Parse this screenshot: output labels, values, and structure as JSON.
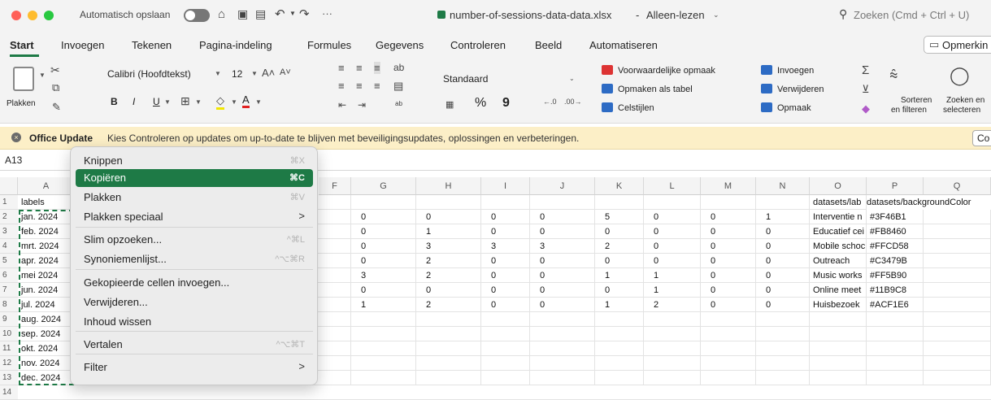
{
  "titlebar": {
    "autosave_label": "Automatisch opslaan",
    "more": "···",
    "file_name": "number-of-sessions-data-data.xlsx",
    "read_only": "Alleen-lezen",
    "search_placeholder": "Zoeken (Cmd + Ctrl + U)"
  },
  "tabs": [
    "Start",
    "Invoegen",
    "Tekenen",
    "Pagina-indeling",
    "Formules",
    "Gegevens",
    "Controleren",
    "Beeld",
    "Automatiseren"
  ],
  "comment_button": "Opmerkin",
  "ribbon": {
    "paste": "Plakken",
    "font_name": "Calibri (Hoofdtekst)",
    "font_size": "12",
    "bold": "B",
    "italic": "I",
    "underline": "U",
    "number_format": "Standaard",
    "percent": "%",
    "comma": "9",
    "cond_format": "Voorwaardelijke opmaak",
    "format_table": "Opmaken als tabel",
    "cell_styles": "Celstijlen",
    "insert": "Invoegen",
    "delete": "Verwijderen",
    "format": "Opmaak",
    "sort_filter_1": "Sorteren",
    "sort_filter_2": "en filteren",
    "find_select_1": "Zoeken en",
    "find_select_2": "selecteren"
  },
  "update_bar": {
    "title": "Office Update",
    "message": "Kies Controleren op updates om up-to-date te blijven met beveiligingsupdates, oplossingen en verbeteringen.",
    "button": "Co"
  },
  "formula_bar": {
    "name_box": "A13"
  },
  "columns": [
    "A",
    "F",
    "G",
    "H",
    "I",
    "J",
    "K",
    "L",
    "M",
    "N",
    "O",
    "P",
    "Q"
  ],
  "rows": [
    "1",
    "2",
    "3",
    "4",
    "5",
    "6",
    "7",
    "8",
    "9",
    "10",
    "11",
    "12",
    "13",
    "14"
  ],
  "col_a": [
    "labels",
    "jan. 2024",
    "feb. 2024",
    "mrt. 2024",
    "apr. 2024",
    "mei 2024",
    "jun. 2024",
    "jul. 2024",
    "aug. 2024",
    "sep. 2024",
    "okt. 2024",
    "nov. 2024",
    "dec. 2024"
  ],
  "data_rows": [
    [
      "0",
      "0",
      "0",
      "0",
      "5",
      "0",
      "0",
      "1"
    ],
    [
      "0",
      "1",
      "0",
      "0",
      "0",
      "0",
      "0",
      "0"
    ],
    [
      "0",
      "3",
      "3",
      "3",
      "2",
      "0",
      "0",
      "0"
    ],
    [
      "0",
      "2",
      "0",
      "0",
      "0",
      "0",
      "0",
      "0"
    ],
    [
      "3",
      "2",
      "0",
      "0",
      "1",
      "1",
      "0",
      "0"
    ],
    [
      "0",
      "0",
      "0",
      "0",
      "0",
      "1",
      "0",
      "0"
    ],
    [
      "1",
      "2",
      "0",
      "0",
      "1",
      "2",
      "0",
      "0"
    ]
  ],
  "col_o": [
    "datasets/lab",
    "Interventie n",
    "Educatief cei",
    "Mobile schoc",
    "Outreach",
    "Music works",
    "Online meet",
    "Huisbezoek"
  ],
  "col_p": [
    "datasets/backgroundColor",
    "#3F46B1",
    "#FB8460",
    "#FFCD58",
    "#C3479B",
    "#FF5B90",
    "#11B9C8",
    "#ACF1E6"
  ],
  "context_menu": [
    {
      "label": "Knippen",
      "shortcut": "⌘X"
    },
    {
      "label": "Kopiëren",
      "shortcut": "⌘C"
    },
    {
      "label": "Plakken",
      "shortcut": "⌘V"
    },
    {
      "label": "Plakken speciaal",
      "shortcut": ">"
    },
    {
      "label": "Slim opzoeken...",
      "shortcut": "^⌘L"
    },
    {
      "label": "Synoniemenlijst...",
      "shortcut": "^⌥⌘R"
    },
    {
      "label": "Gekopieerde cellen invoegen...",
      "shortcut": ""
    },
    {
      "label": "Verwijderen...",
      "shortcut": ""
    },
    {
      "label": "Inhoud wissen",
      "shortcut": ""
    },
    {
      "label": "Vertalen",
      "shortcut": "^⌥⌘T"
    },
    {
      "label": "Filter",
      "shortcut": ">"
    }
  ],
  "colors": {
    "accent": "#1e7a46",
    "update_bg": "#fcefc7",
    "close": "#ff5f57",
    "minimize": "#febc2e",
    "maximize": "#28c840"
  }
}
